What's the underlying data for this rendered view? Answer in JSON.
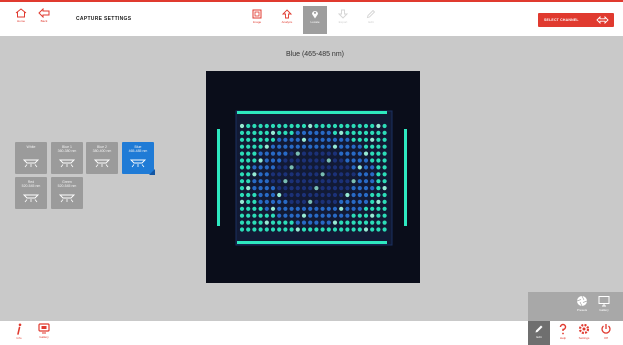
{
  "header": {
    "home_label": "Home",
    "back_label": "Back",
    "title": "CAPTURE SETTINGS",
    "steps": [
      {
        "label": "Image",
        "icon": "image-icon",
        "state": "normal"
      },
      {
        "label": "Analyze",
        "icon": "upload-icon",
        "state": "normal"
      },
      {
        "label": "Locate",
        "icon": "locate-pin-icon",
        "state": "active"
      },
      {
        "label": "Export",
        "icon": "download-icon",
        "state": "disabled"
      },
      {
        "label": "Edit",
        "icon": "pencil-icon",
        "state": "disabled"
      }
    ],
    "select_button_label": "SELECT CHANNEL"
  },
  "main": {
    "image_title": "Blue (465-485 nm)"
  },
  "channels": [
    {
      "name": "White",
      "range": ""
    },
    {
      "name": "Blue 1",
      "range": "360-380 nm"
    },
    {
      "name": "Blue 2",
      "range": "380-400 nm"
    },
    {
      "name": "Blue",
      "range": "465-485 nm",
      "selected": true
    },
    {
      "name": "Red",
      "range": "520-545 nm"
    },
    {
      "name": "Green",
      "range": "520-545 nm"
    }
  ],
  "bottom": {
    "info_label": "Info",
    "gallery_label": "Gallery",
    "edit_label": "Edit",
    "help_label": "Help",
    "settings_label": "Settings",
    "power_label": "Off",
    "tray": [
      {
        "label": "Presets",
        "icon": "aperture-icon"
      },
      {
        "label": "Gallery",
        "icon": "monitor-icon"
      }
    ]
  },
  "colors": {
    "accent": "#e03a2f",
    "tile": "#9b9b9b",
    "tile_active": "#1f7bd6",
    "background": "#c9c9c9",
    "gel_bg": "#0a0d1a",
    "gel_glow": "#2ee8c0"
  }
}
